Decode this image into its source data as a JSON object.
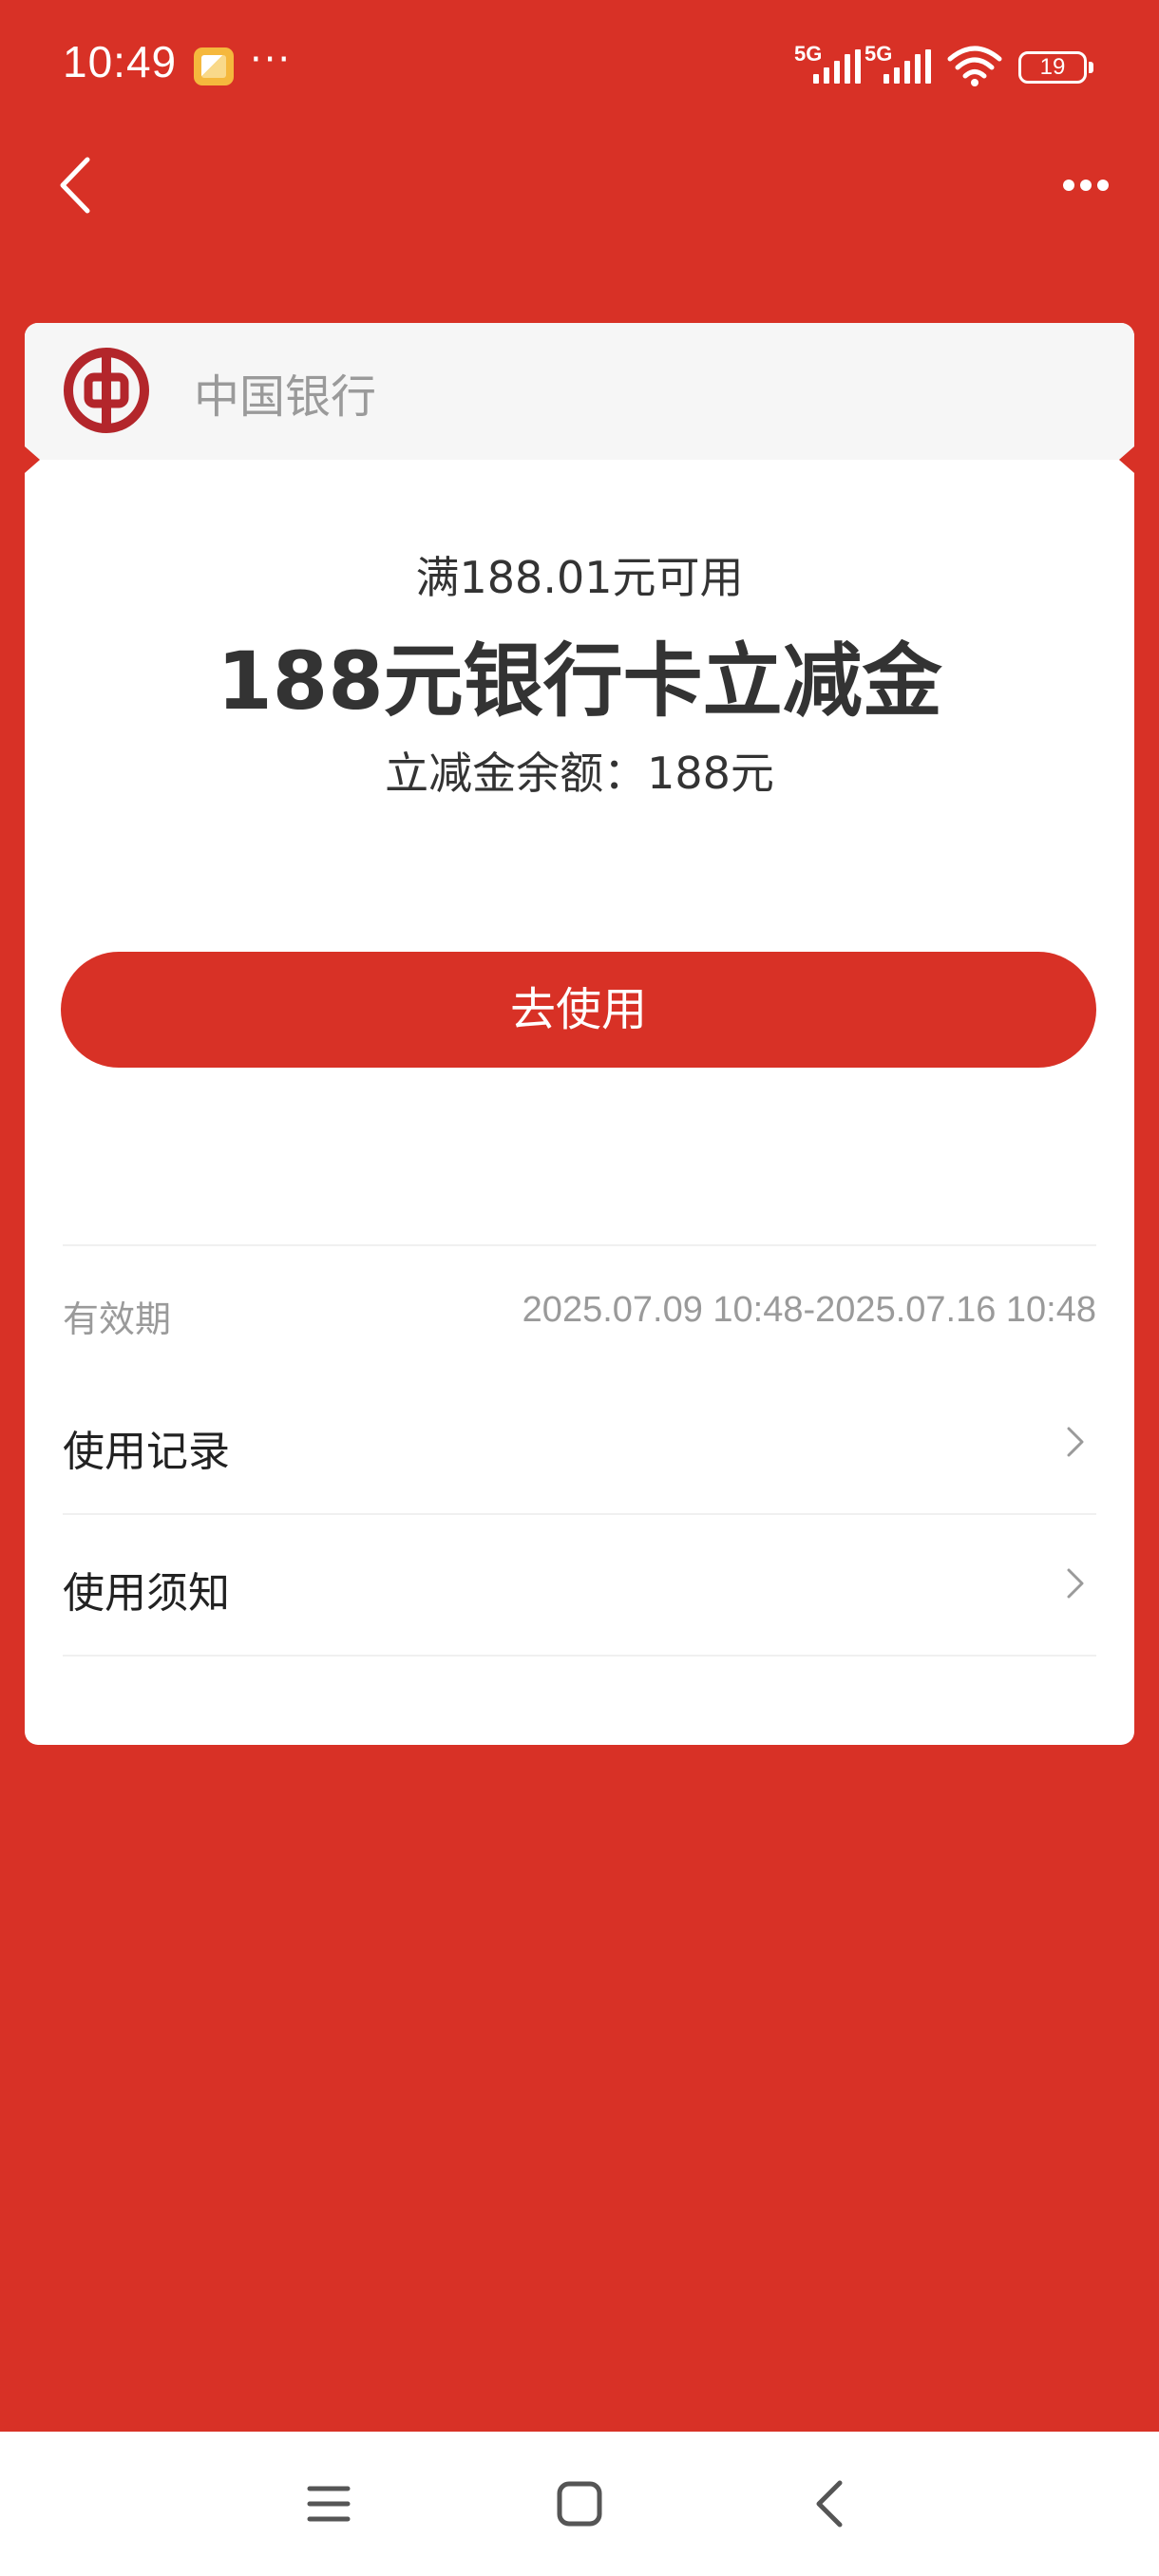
{
  "status_bar": {
    "time": "10:49",
    "more": "···",
    "signal1_label": "5G",
    "signal2_label": "5G",
    "battery_level": "19"
  },
  "nav": {
    "back_icon": "chevron-left-icon",
    "menu_icon": "more-horizontal-icon"
  },
  "card": {
    "bank_name": "中国银行",
    "threshold": "满188.01元可用",
    "title": "188元银行卡立减金",
    "balance": "立减金余额：188元",
    "use_button": "去使用",
    "validity_label": "有效期",
    "validity_value": "2025.07.09 10:48-2025.07.16 10:48",
    "rows": [
      {
        "label": "使用记录"
      },
      {
        "label": "使用须知"
      }
    ]
  },
  "colors": {
    "brand_red": "#d83126",
    "card_bg": "#ffffff",
    "header_bg": "#f6f6f6",
    "muted_text": "#9a9a9a"
  }
}
